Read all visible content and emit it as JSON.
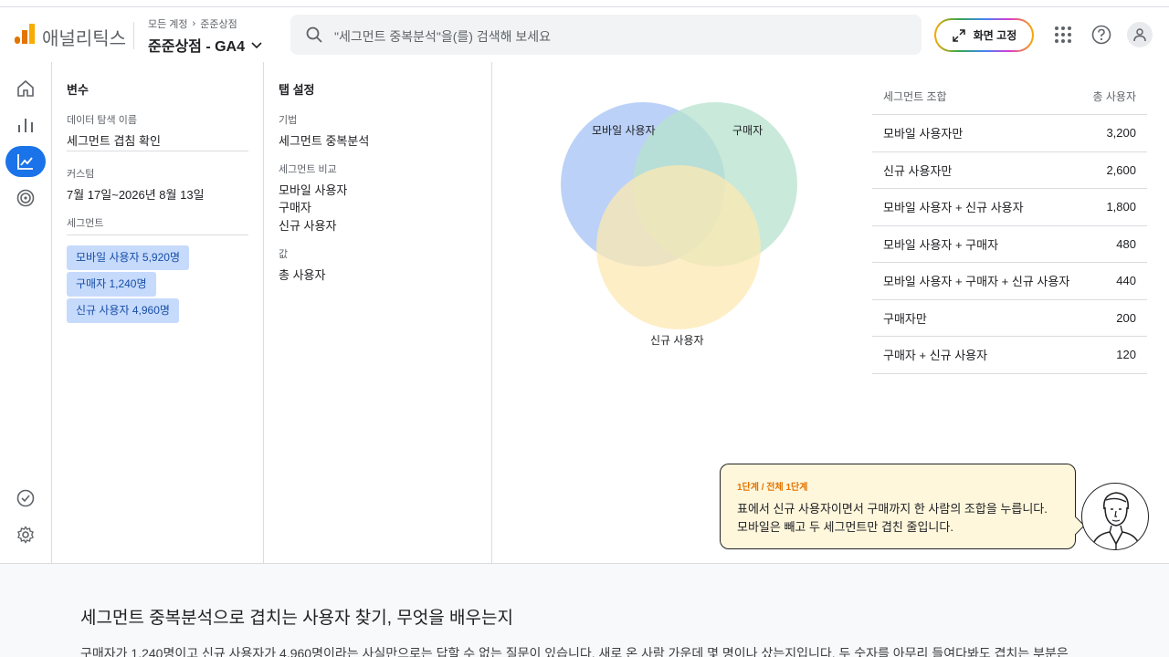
{
  "header": {
    "app_name": "애널리틱스",
    "breadcrumb_root": "모든 계정",
    "breadcrumb_child": "준준상점",
    "property_name": "준준상점 - GA4",
    "search_placeholder": "\"세그먼트 중복분석\"을(를) 검색해 보세요",
    "pin_label": "화면 고정"
  },
  "variables_panel": {
    "title": "변수",
    "exploration_name_label": "데이터 탐색 이름",
    "exploration_name": "세그먼트 겹침 확인",
    "custom_label": "커스텀",
    "date_range": "7월 17일~2026년 8월 13일",
    "segments_label": "세그먼트",
    "segments": [
      "모바일 사용자 5,920명",
      "구매자 1,240명",
      "신규 사용자 4,960명"
    ]
  },
  "tab_settings": {
    "title": "탭 설정",
    "technique_label": "기법",
    "technique": "세그먼트 중복분석",
    "compare_label": "세그먼트 비교",
    "compare_items": [
      "모바일 사용자",
      "구매자",
      "신규 사용자"
    ],
    "values_label": "값",
    "value": "총 사용자"
  },
  "venn": {
    "labels": [
      "모바일 사용자",
      "구매자",
      "신규 사용자"
    ],
    "colors": [
      "#a4c2f4",
      "#b7e1cd",
      "#fce8b2"
    ]
  },
  "table": {
    "col_segment": "세그먼트 조합",
    "col_users": "총 사용자",
    "rows": [
      {
        "segment": "모바일 사용자만",
        "users": "3,200"
      },
      {
        "segment": "신규 사용자만",
        "users": "2,600"
      },
      {
        "segment": "모바일 사용자 + 신규 사용자",
        "users": "1,800"
      },
      {
        "segment": "모바일 사용자 + 구매자",
        "users": "480"
      },
      {
        "segment": "모바일 사용자 + 구매자 + 신규 사용자",
        "users": "440"
      },
      {
        "segment": "구매자만",
        "users": "200"
      },
      {
        "segment": "구매자 + 신규 사용자",
        "users": "120"
      }
    ]
  },
  "coach": {
    "step": "1단계 / 전체 1단계",
    "line1": "표에서 신규 사용자이면서 구매까지 한 사람의 조합을 누릅니다.",
    "line2": "모바일은 빼고 두 세그먼트만 겹친 줄입니다."
  },
  "article": {
    "title": "세그먼트 중복분석으로 겹치는 사용자 찾기, 무엇을 배우는지",
    "body": "구매자가 1,240명이고 신규 사용자가 4,960명이라는 사실만으로는 답할 수 없는 질문이 있습니다. 새로 온 사람 가운데 몇 명이나 샀는지입니다. 두 숫자를 아무리 들여다봐도 겹치는 부분은"
  }
}
